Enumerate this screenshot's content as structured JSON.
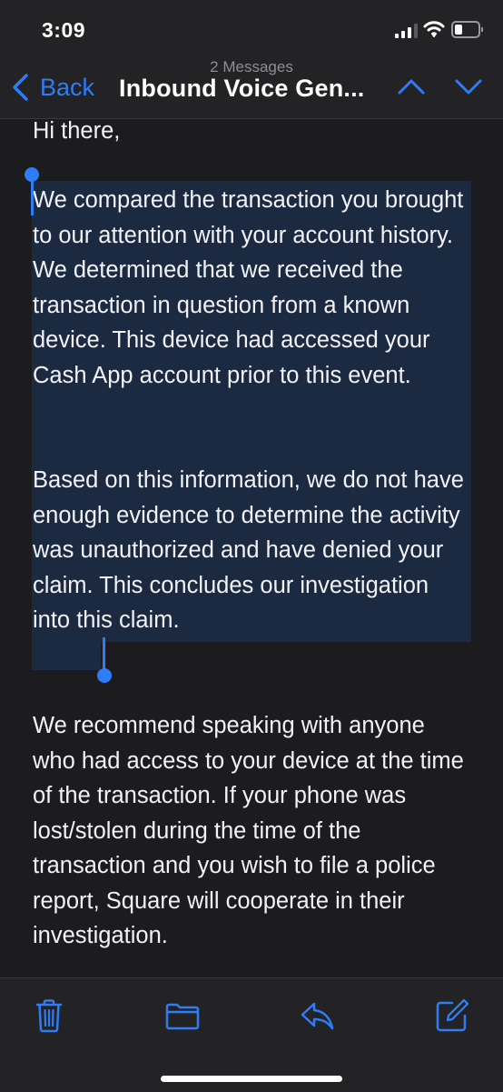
{
  "status_bar": {
    "time": "3:09"
  },
  "nav": {
    "back_label": "Back",
    "subtitle": "2 Messages",
    "title": "Inbound Voice Gen..."
  },
  "message": {
    "greeting": "Hi there,",
    "paragraph_1": "We compared the transaction you brought to our attention with your account history. We determined that we received the transaction in question from a known device. This device had accessed your Cash App account prior to this event.",
    "paragraph_2": "Based on this information, we do not have enough evidence to determine the activity was unauthorized and have denied your claim. This concludes our investigation into this claim.",
    "paragraph_3": "We recommend speaking with anyone who had access to your device at the time of the transaction. If your phone was lost/stolen during the time of the transaction and you wish to file a police report, Square will cooperate in their investigation."
  },
  "toolbar": {
    "icons": [
      "trash-icon",
      "folder-icon",
      "reply-icon",
      "compose-icon"
    ]
  },
  "colors": {
    "accent": "#2e7cf6",
    "background": "#1c1c1e",
    "bar_background": "#232325",
    "selection": "#1b2a40",
    "text": "#f2f2f7",
    "secondary_text": "#8e8e93"
  }
}
